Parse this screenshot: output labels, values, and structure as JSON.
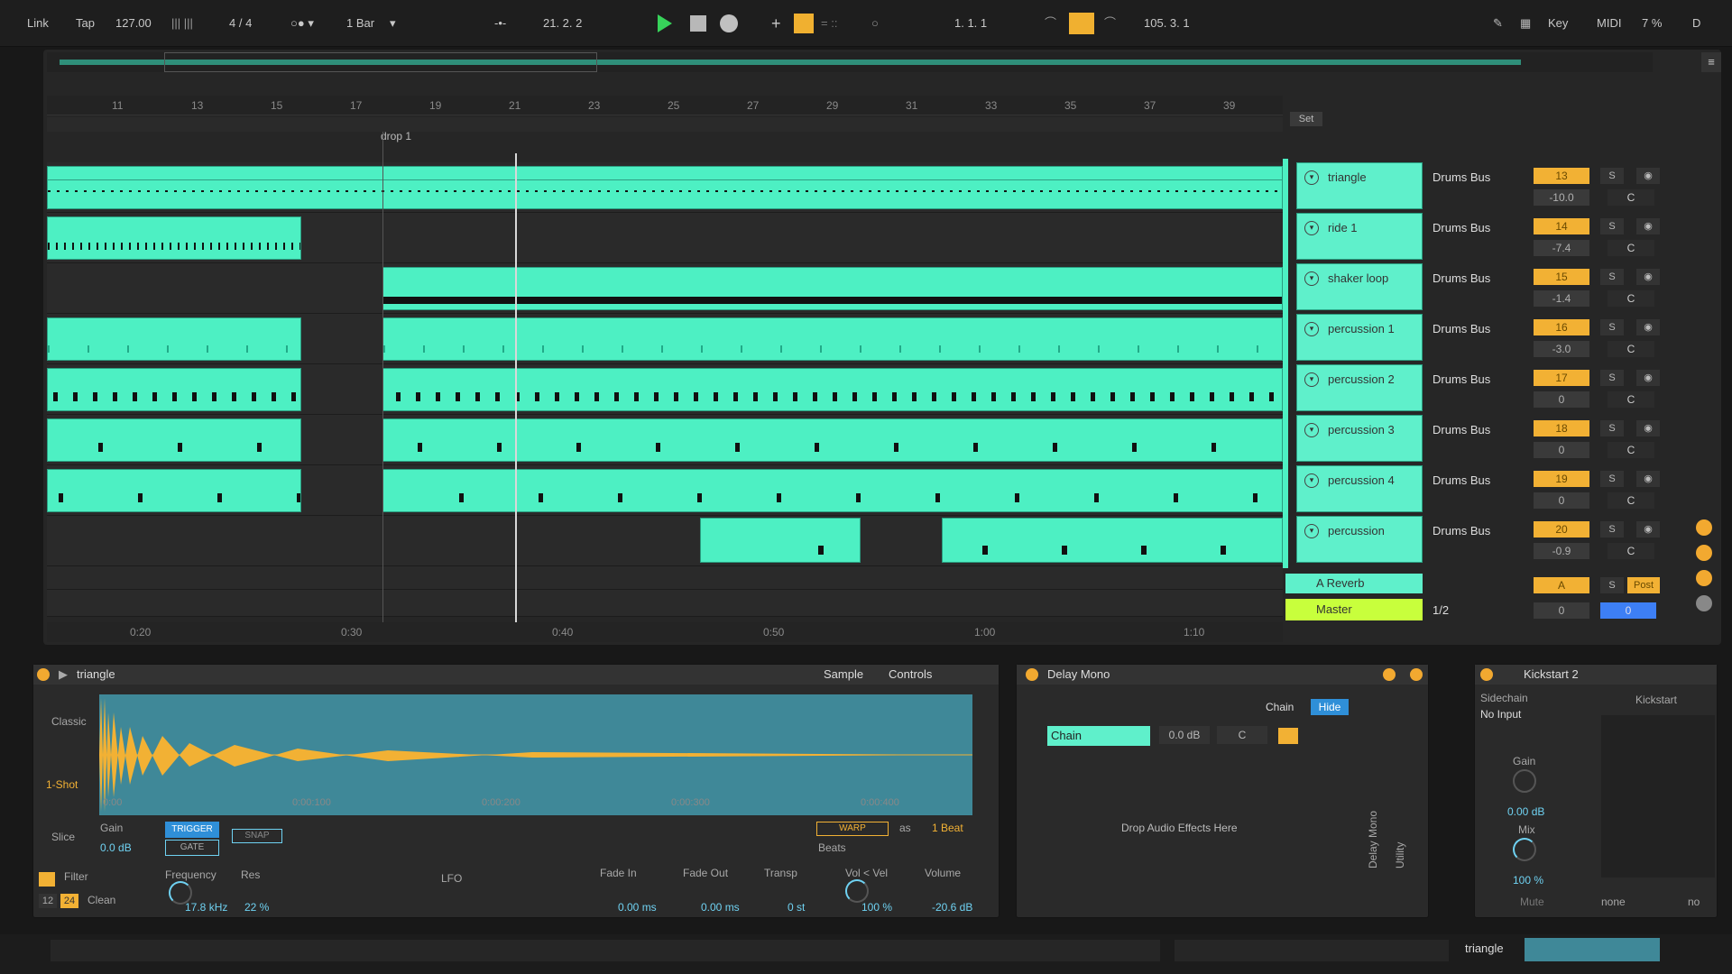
{
  "transport": {
    "link": "Link",
    "tap": "Tap",
    "tempo": "127.00",
    "signature": "4 / 4",
    "quantize": "1 Bar",
    "position": "21.  2.  2",
    "loop_start": "1.  1.  1",
    "loop_length": "105.  3.  1",
    "key": "Key",
    "midi": "MIDI",
    "cpu": "7 %",
    "d_indicator": "D"
  },
  "ruler": {
    "bars": [
      "11",
      "13",
      "15",
      "17",
      "19",
      "21",
      "23",
      "25",
      "27",
      "29",
      "31",
      "33",
      "35",
      "37",
      "39"
    ],
    "set_label": "Set"
  },
  "locator": "drop 1",
  "timeline": [
    "0:20",
    "0:30",
    "0:40",
    "0:50",
    "1:00",
    "1:10"
  ],
  "tracks": [
    {
      "name": "triangle",
      "io": "Drums Bus",
      "num": "13",
      "vol": "-10.0",
      "pan": "C"
    },
    {
      "name": "ride 1",
      "io": "Drums Bus",
      "num": "14",
      "vol": "-7.4",
      "pan": "C"
    },
    {
      "name": "shaker loop",
      "io": "Drums Bus",
      "num": "15",
      "vol": "-1.4",
      "pan": "C"
    },
    {
      "name": "percussion 1",
      "io": "Drums Bus",
      "num": "16",
      "vol": "-3.0",
      "pan": "C"
    },
    {
      "name": "percussion 2",
      "io": "Drums Bus",
      "num": "17",
      "vol": "0",
      "pan": "C"
    },
    {
      "name": "percussion 3",
      "io": "Drums Bus",
      "num": "18",
      "vol": "0",
      "pan": "C"
    },
    {
      "name": "percussion 4",
      "io": "Drums Bus",
      "num": "19",
      "vol": "0",
      "pan": "C"
    },
    {
      "name": "percussion",
      "io": "Drums Bus",
      "num": "20",
      "vol": "-0.9",
      "pan": "C"
    }
  ],
  "returns": {
    "reverb": {
      "name": "A Reverb",
      "num": "A",
      "solo": "S",
      "post": "Post"
    },
    "master": {
      "name": "Master",
      "io": "1/2",
      "vol": "0",
      "pan": "0"
    }
  },
  "sampler": {
    "title": "triangle",
    "tab_sample": "Sample",
    "tab_controls": "Controls",
    "mode_classic": "Classic",
    "mode_oneshot": "1-Shot",
    "mode_slice": "Slice",
    "gain_label": "Gain",
    "gain_value": "0.0 dB",
    "trigger": "TRIGGER",
    "gate": "GATE",
    "snap": "SNAP",
    "warp": "WARP",
    "as": "as",
    "beat": "1 Beat",
    "beats": "Beats",
    "wave_times": [
      "0:00",
      "0:00:100",
      "0:00:200",
      "0:00:300",
      "0:00:400"
    ],
    "filter": "Filter",
    "filter_db_12": "12",
    "filter_db_24": "24",
    "filter_type": "Clean",
    "freq_label": "Frequency",
    "freq_value": "17.8 kHz",
    "res_label": "Res",
    "res_value": "22 %",
    "lfo": "LFO",
    "fadein_label": "Fade In",
    "fadein_value": "0.00 ms",
    "fadeout_label": "Fade Out",
    "fadeout_value": "0.00 ms",
    "transp_label": "Transp",
    "transp_value": "0 st",
    "velvol_label": "Vol < Vel",
    "velvol_value": "100 %",
    "volume_label": "Volume",
    "volume_value": "-20.6 dB"
  },
  "delay": {
    "title": "Delay Mono",
    "chain_label": "Chain",
    "hide": "Hide",
    "chain_name": "Chain",
    "chain_vol": "0.0 dB",
    "chain_pan": "C",
    "drop_hint": "Drop Audio Effects Here",
    "vert_delay": "Delay Mono",
    "vert_utility": "Utility"
  },
  "kickstart": {
    "title": "Kickstart 2",
    "sidechain": "Sidechain",
    "input": "No Input",
    "gain_label": "Gain",
    "gain_value": "0.00 dB",
    "mix_label": "Mix",
    "mix_value": "100 %",
    "mute": "Mute",
    "kick_label": "Kickstart",
    "none": "none",
    "no": "no"
  },
  "statusbar": {
    "track": "triangle"
  }
}
